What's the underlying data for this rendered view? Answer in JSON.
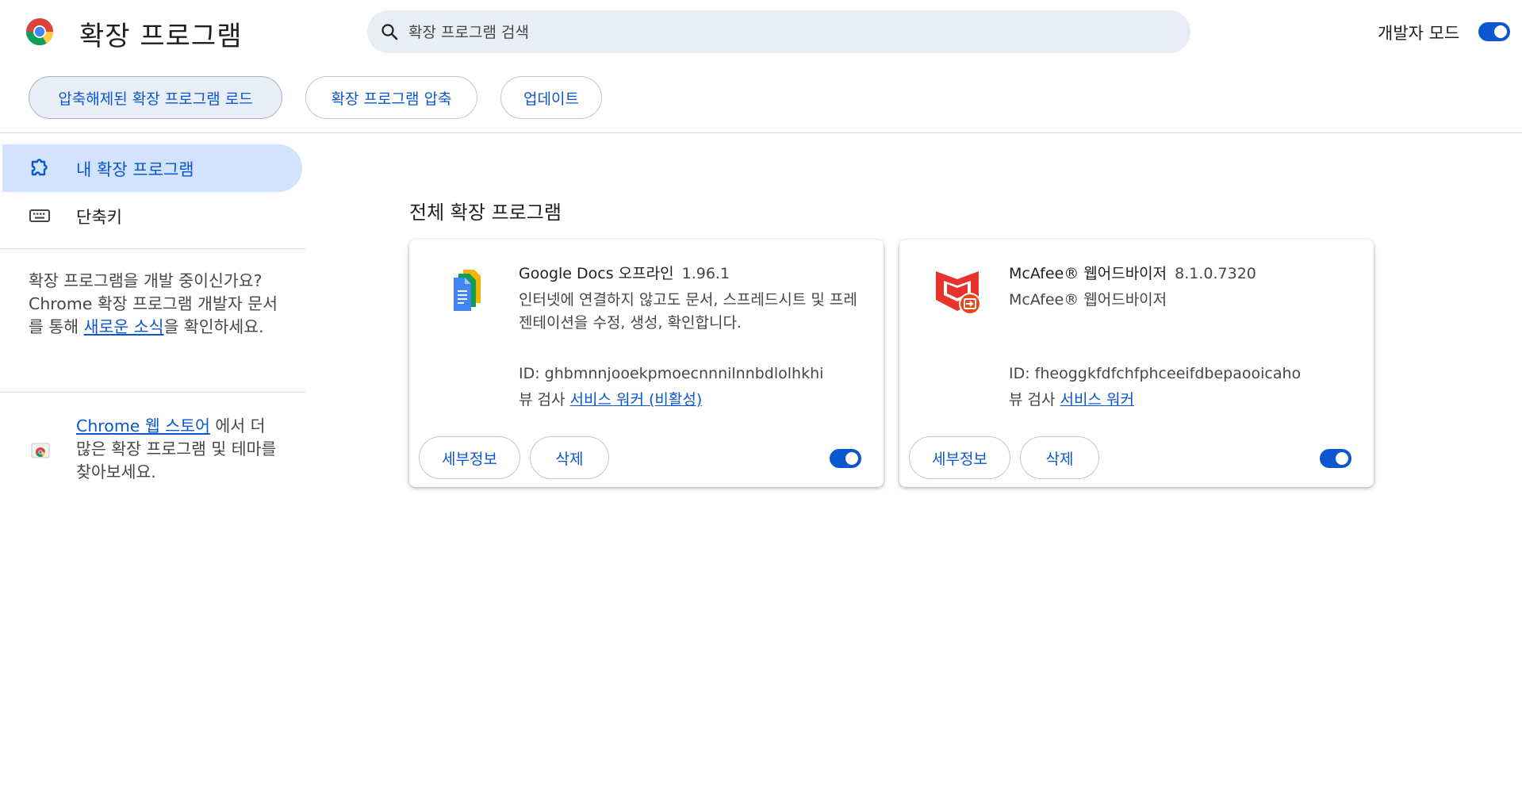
{
  "header": {
    "title": "확장 프로그램",
    "search_placeholder": "확장 프로그램 검색",
    "dev_mode_label": "개발자 모드",
    "dev_mode_on": true
  },
  "toolbar": {
    "load_unpacked": "압축해제된 확장 프로그램 로드",
    "pack": "확장 프로그램 압축",
    "update": "업데이트"
  },
  "sidebar": {
    "items": [
      {
        "label": "내 확장 프로그램",
        "icon": "extension-icon",
        "active": true
      },
      {
        "label": "단축키",
        "icon": "keyboard-icon",
        "active": false
      }
    ],
    "dev_promo": {
      "before": "확장 프로그램을 개발 중이신가요? Chrome 확장 프로그램 개발자 문서를 통해 ",
      "link": "새로운 소식",
      "after": "을 확인하세요."
    },
    "store_promo": {
      "link": "Chrome 웹 스토어",
      "after": " 에서 더 많은 확장 프로그램 및 테마를 찾아보세요."
    }
  },
  "main": {
    "heading": "전체 확장 프로그램",
    "extensions": [
      {
        "name": "Google Docs 오프라인",
        "version": "1.96.1",
        "description": "인터넷에 연결하지 않고도 문서, 스프레드시트 및 프레젠테이션을 수정, 생성, 확인합니다.",
        "id": "ID: ghbmnnjooekpmoecnnnilnnbdlolhkhi",
        "inspect_label": "뷰 검사",
        "inspect_link": "서비스 워커 (비활성)",
        "details_label": "세부정보",
        "remove_label": "삭제",
        "enabled": true
      },
      {
        "name": "McAfee® 웹어드바이저",
        "version": "8.1.0.7320",
        "description": "McAfee® 웹어드바이저",
        "id": "ID: fheoggkfdfchfphceeifdbepaooicaho",
        "inspect_label": "뷰 검사",
        "inspect_link": "서비스 워커",
        "details_label": "세부정보",
        "remove_label": "삭제",
        "enabled": true
      }
    ]
  },
  "colors": {
    "accent": "#0b57d0",
    "active_nav_bg": "#d3e3fd",
    "search_bg": "#e9eef6"
  }
}
